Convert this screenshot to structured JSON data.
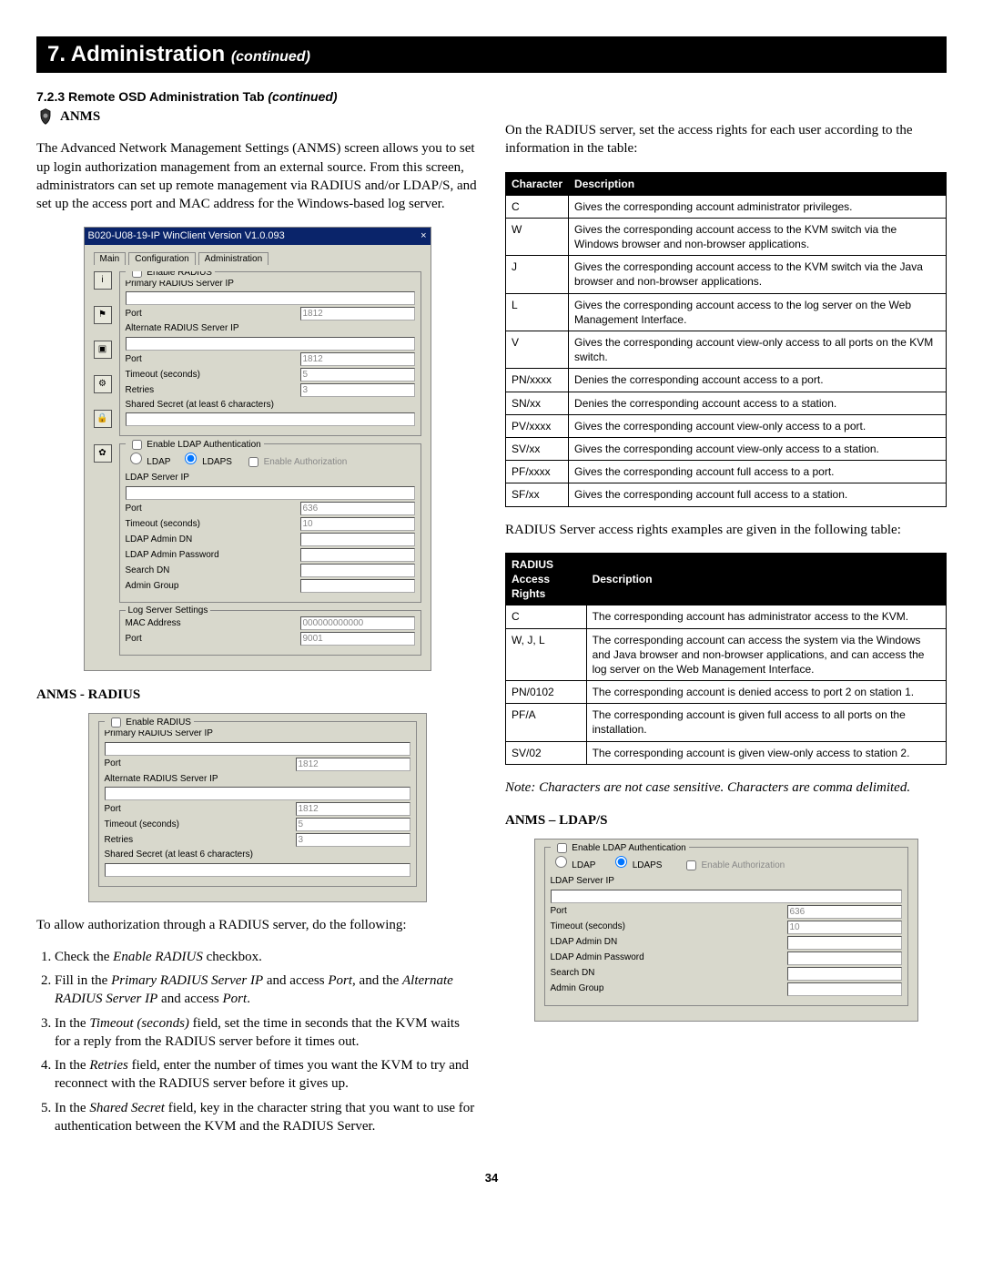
{
  "chapter": {
    "num": "7.",
    "title": "Administration",
    "cont": "(continued)"
  },
  "section": {
    "num": "7.2.3",
    "title": "Remote OSD Administration Tab",
    "cont": "(continued)"
  },
  "anms": {
    "heading": "ANMS",
    "intro": "The Advanced Network Management Settings (ANMS) screen allows you to set up login authorization management from an external source. From this screen, administrators can set up remote management via RADIUS and/or LDAP/S, and set up the access port and MAC address for the Windows-based log server."
  },
  "win": {
    "title": "B020-U08-19-IP WinClient Version V1.0.093",
    "close": "×",
    "tabs": [
      "Main",
      "Configuration",
      "Administration"
    ],
    "radius": {
      "enable": "Enable RADIUS",
      "primary_ip": "Primary RADIUS Server IP",
      "port": "Port",
      "port_val": "1812",
      "alt_ip": "Alternate RADIUS Server IP",
      "alt_port_val": "1812",
      "timeout": "Timeout (seconds)",
      "timeout_val": "5",
      "retries": "Retries",
      "retries_val": "3",
      "secret": "Shared Secret (at least 6 characters)"
    },
    "ldap": {
      "enable": "Enable LDAP Authentication",
      "ldap": "LDAP",
      "ldaps": "LDAPS",
      "enable_auth": "Enable Authorization",
      "server_ip": "LDAP Server IP",
      "port": "Port",
      "port_val": "636",
      "timeout": "Timeout (seconds)",
      "timeout_val": "10",
      "admin_dn": "LDAP Admin DN",
      "admin_pw": "LDAP Admin  Password",
      "search_dn": "Search DN",
      "admin_group": "Admin Group"
    },
    "log": {
      "legend": "Log Server Settings",
      "mac": "MAC Address",
      "mac_val": "000000000000",
      "port": "Port",
      "port_val": "9001"
    }
  },
  "radius_section": {
    "heading": "ANMS - RADIUS",
    "intro": "To allow authorization through a RADIUS server, do the following:",
    "steps": [
      "Check the <i>Enable RADIUS</i> checkbox.",
      "Fill in the <i>Primary RADIUS Server IP</i> and access <i>Port</i>, and the <i>Alternate RADIUS Server IP</i> and access <i>Port</i>.",
      "In the <i>Timeout (seconds)</i> field, set the time in seconds that the KVM waits for a reply from the RADIUS server before it times out.",
      "In the <i>Retries</i> field, enter the number of times you want the KVM to try and reconnect with the RADIUS server before it gives up.",
      "In the <i>Shared Secret</i> field, key in the character string that you want to use for authentication between the KVM and the RADIUS Server."
    ]
  },
  "right": {
    "lead": "On the RADIUS server, set the access rights for each user according to the information in the table:",
    "table1": {
      "headers": [
        "Character",
        "Description"
      ],
      "rows": [
        [
          "C",
          "Gives the corresponding account administrator privileges."
        ],
        [
          "W",
          "Gives the corresponding account access to the KVM switch via the Windows browser and non-browser applications."
        ],
        [
          "J",
          "Gives the corresponding account access to the KVM switch via the Java browser and non-browser applications."
        ],
        [
          "L",
          "Gives the corresponding account access to the log server on the Web Management Interface."
        ],
        [
          "V",
          "Gives the corresponding account view-only access to all ports on the KVM switch."
        ],
        [
          "PN/xxxx",
          "Denies the corresponding account access to a port."
        ],
        [
          "SN/xx",
          "Denies the corresponding account access to a station."
        ],
        [
          "PV/xxxx",
          "Gives the corresponding account view-only access to a port."
        ],
        [
          "SV/xx",
          "Gives the corresponding account view-only access to a station."
        ],
        [
          "PF/xxxx",
          "Gives the corresponding account full access to a port."
        ],
        [
          "SF/xx",
          "Gives the corresponding account full access to a station."
        ]
      ]
    },
    "mid": "RADIUS Server access rights examples are given in the following table:",
    "table2": {
      "headers": [
        "RADIUS Access Rights",
        "Description"
      ],
      "rows": [
        [
          "C",
          "The corresponding account has administrator access to the KVM."
        ],
        [
          "W, J, L",
          "The corresponding account can access the system via the Windows and Java browser and non-browser applications, and can access the log server on the Web Management Interface."
        ],
        [
          "PN/0102",
          "The corresponding account is denied access to port 2 on station 1."
        ],
        [
          "PF/A",
          "The corresponding account is given full access to all ports on the installation."
        ],
        [
          "SV/02",
          "The corresponding account is given view-only access to station 2."
        ]
      ]
    },
    "note": "Note: Characters are not case sensitive. Characters are comma delimited.",
    "ldap_heading": "ANMS – LDAP/S"
  },
  "page_num": "34"
}
